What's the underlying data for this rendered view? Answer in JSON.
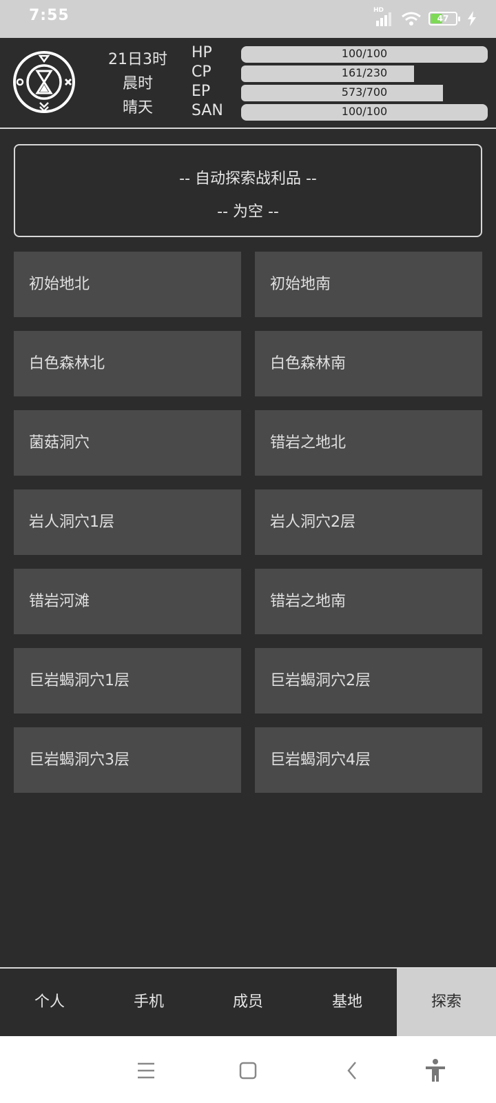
{
  "status_bar": {
    "time": "7:55",
    "battery_level": "47",
    "network_label": "HD"
  },
  "header": {
    "day": "21日3时",
    "period": "晨时",
    "weather": "晴天",
    "stats": [
      {
        "label": "HP",
        "text": "100/100",
        "current": 100,
        "max": 100
      },
      {
        "label": "CP",
        "text": "161/230",
        "current": 161,
        "max": 230
      },
      {
        "label": "EP",
        "text": "573/700",
        "current": 573,
        "max": 700
      },
      {
        "label": "SAN",
        "text": "100/100",
        "current": 100,
        "max": 100
      }
    ]
  },
  "loot": {
    "title": "-- 自动探索战利品 --",
    "status": "-- 为空 --"
  },
  "locations": [
    "初始地北",
    "初始地南",
    "白色森林北",
    "白色森林南",
    "菌菇洞穴",
    "错岩之地北",
    "岩人洞穴1层",
    "岩人洞穴2层",
    "错岩河滩",
    "错岩之地南",
    "巨岩蝎洞穴1层",
    "巨岩蝎洞穴2层",
    "巨岩蝎洞穴3层",
    "巨岩蝎洞穴4层"
  ],
  "bottom_nav": [
    {
      "label": "个人",
      "active": false
    },
    {
      "label": "手机",
      "active": false
    },
    {
      "label": "成员",
      "active": false
    },
    {
      "label": "基地",
      "active": false
    },
    {
      "label": "探索",
      "active": true
    }
  ],
  "colors": {
    "background": "#2c2c2c",
    "tile": "#4a4a4a",
    "bar": "#d2d2d2",
    "active_tab": "#d0d0d0",
    "battery": "#7ed957"
  }
}
